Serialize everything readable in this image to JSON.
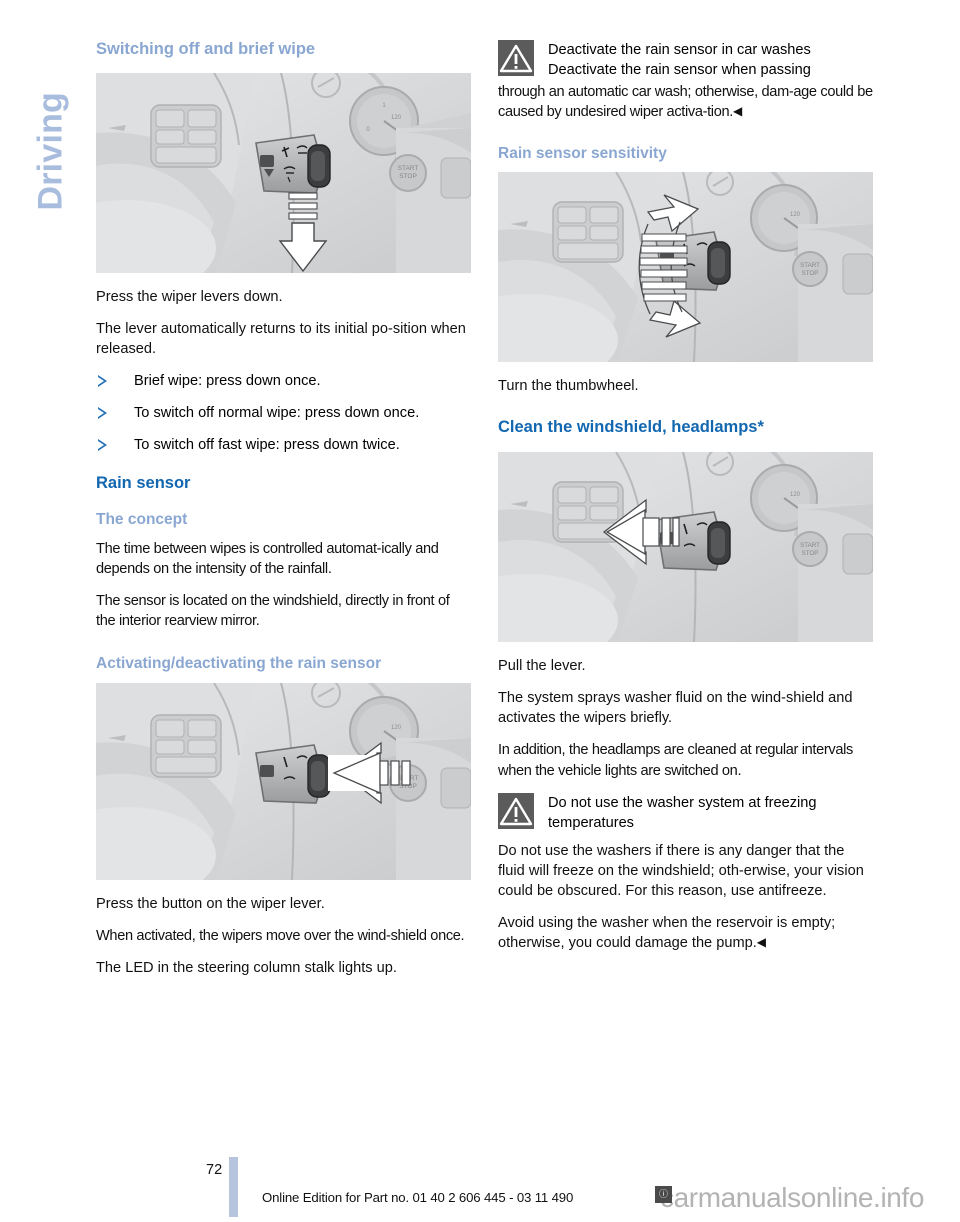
{
  "sidebar": {
    "chapter_label": "Driving"
  },
  "left_column": {
    "section_title": "Switching off and brief wipe",
    "figure1_alt": "steering-column-wiper-lever-press-down",
    "paragraphs": [
      "Press the wiper levers down.",
      "The lever automatically returns to its initial po-sition when released."
    ],
    "bullets": [
      "Brief wipe: press down once.",
      "To switch off normal wipe: press down once.",
      "To switch off fast wipe: press down twice."
    ],
    "rain_sensor_title": "Rain sensor",
    "concept_title": "The concept",
    "concept_paragraphs": [
      "The time between wipes is controlled automat-ically and depends on the intensity of the rainfall.",
      "The sensor is located on the windshield, directly in front of the interior rearview mirror."
    ],
    "activating_title": "Activating/deactivating the rain sensor",
    "figure2_alt": "steering-column-wiper-lever-press-button",
    "after_figure_paragraphs": [
      "Press the button on the wiper lever.",
      "When activated, the wipers move over the wind-shield once.",
      "The LED in the steering column stalk lights up."
    ]
  },
  "right_column": {
    "warning1": {
      "icon": "warning-triangle-icon",
      "heading": "Deactivate the rain sensor in car washes",
      "body_lead": "Deactivate the rain sensor when passing",
      "body_rest": "through an automatic car wash; otherwise, dam-age could be caused by undesired wiper activa-tion.",
      "end_mark": "◀"
    },
    "sensitivity_title": "Rain sensor sensitivity",
    "figure3_alt": "steering-column-thumbwheel-turn-up-down",
    "sensitivity_caption": "Turn the thumbwheel.",
    "clean_title": "Clean the windshield, headlamps*",
    "figure4_alt": "steering-column-wiper-lever-pull",
    "clean_paragraphs": [
      "Pull the lever.",
      "The system sprays washer fluid on the wind-shield and activates the wipers briefly.",
      "In addition, the headlamps are cleaned at regular intervals when the vehicle lights are switched on."
    ],
    "warning2": {
      "icon": "warning-triangle-icon",
      "heading": "Do not use the washer system at freezing temperatures",
      "paragraphs": [
        "Do not use the washers if there is any danger that the fluid will freeze on the windshield; oth-erwise, your vision could be obscured. For this reason, use antifreeze.",
        "Avoid using the washer when the reservoir is empty; otherwise, you could damage the pump."
      ],
      "end_mark": "◀"
    }
  },
  "footer": {
    "page_number": "72",
    "edition_text": "Online Edition for Part no. 01 40 2 606 445 - 03 11 490",
    "watermark": "carmanualsonline.info",
    "watermark_badge": "ⓘ"
  },
  "colors": {
    "heading_light_blue": "#8aa7d2",
    "heading_dark_blue": "#1267b1",
    "sidebar_tab": "#a8bcdd",
    "warning_icon_bg": "#5b5b5b",
    "figure_bg": "#d8d9db",
    "footer_rule": "#b7c4dd"
  }
}
